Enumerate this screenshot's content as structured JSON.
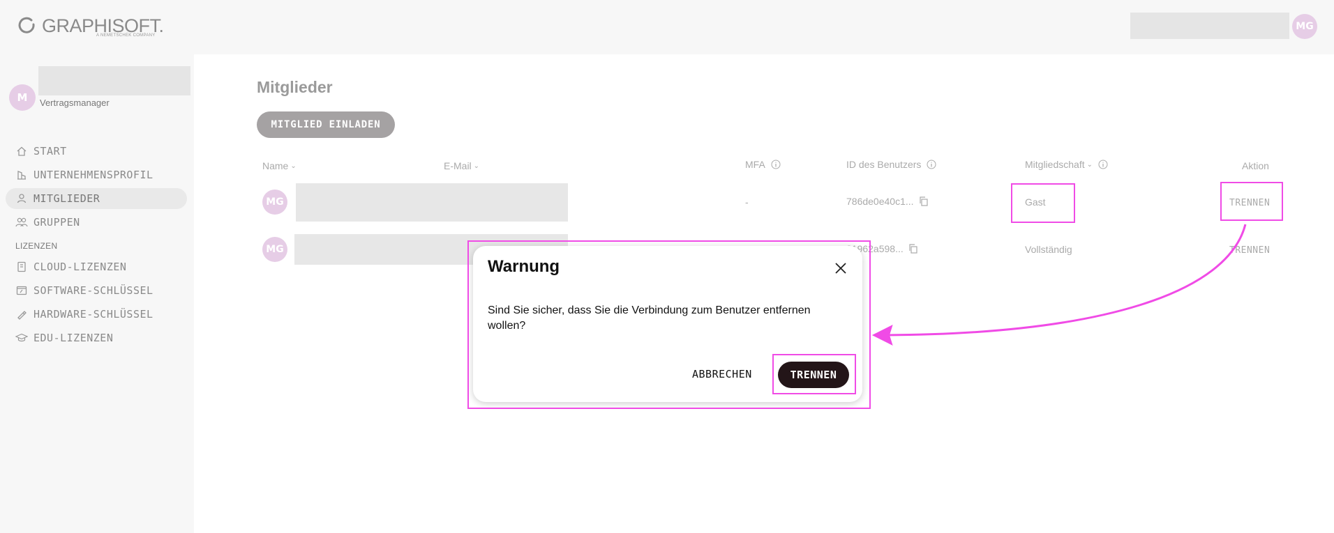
{
  "header": {
    "logo_text": "GRAPHISOFT.",
    "logo_subtext": "A NEMETSCHEK COMPANY",
    "user_initials": "MG"
  },
  "sidebar": {
    "org_initial": "M",
    "org_role": "Vertragsmanager",
    "items": [
      {
        "label": "START",
        "icon": "home-icon"
      },
      {
        "label": "UNTERNEHMENSPROFIL",
        "icon": "building-icon"
      },
      {
        "label": "MITGLIEDER",
        "icon": "user-icon",
        "active": true
      },
      {
        "label": "GRUPPEN",
        "icon": "users-icon"
      }
    ],
    "section_label": "LIZENZEN",
    "license_items": [
      {
        "label": "CLOUD-LIZENZEN",
        "icon": "cloud-license-icon"
      },
      {
        "label": "SOFTWARE-SCHLÜSSEL",
        "icon": "software-key-icon"
      },
      {
        "label": "HARDWARE-SCHLÜSSEL",
        "icon": "hardware-key-icon"
      },
      {
        "label": "EDU-LIZENZEN",
        "icon": "graduation-cap-icon"
      }
    ]
  },
  "main": {
    "title": "Mitglieder",
    "invite_button": "MITGLIED EINLADEN",
    "columns": {
      "name": "Name",
      "email": "E-Mail",
      "mfa": "MFA",
      "user_id": "ID des Benutzers",
      "membership": "Mitgliedschaft",
      "action": "Aktion"
    },
    "rows": [
      {
        "initials": "MG",
        "mfa": "-",
        "user_id": "786de0e40c1...",
        "membership": "Gast",
        "action": "TRENNEN"
      },
      {
        "initials": "MG",
        "mfa": "",
        "user_id": "21962a598...",
        "membership": "Vollständig",
        "action": "TRENNEN"
      }
    ]
  },
  "modal": {
    "title": "Warnung",
    "message": "Sind Sie sicher, dass Sie die Verbindung zum Benutzer entfernen wollen?",
    "cancel_label": "ABBRECHEN",
    "confirm_label": "TRENNEN"
  },
  "colors": {
    "annotation": "#f04be6",
    "avatar": "#e6cde6",
    "confirm_button": "#231518",
    "invite_button": "#a5a2a3"
  }
}
